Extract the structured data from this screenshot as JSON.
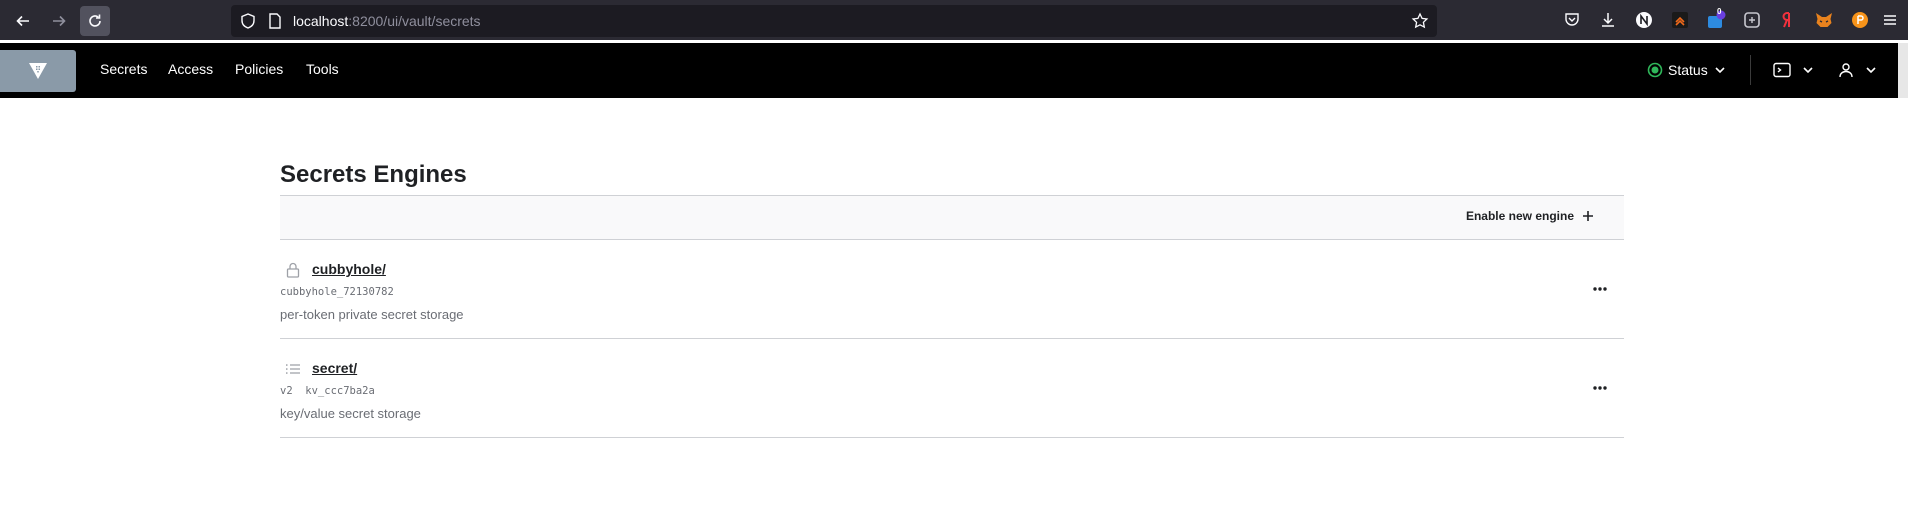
{
  "browser": {
    "url_host": "localhost",
    "url_path": ":8200/ui/vault/secrets",
    "extension_badge": "0"
  },
  "nav": {
    "links": [
      "Secrets",
      "Access",
      "Policies",
      "Tools"
    ],
    "status_label": "Status",
    "status_color": "#2fb75a"
  },
  "main": {
    "title": "Secrets Engines",
    "enable_button": "Enable new engine",
    "engines": [
      {
        "icon": "lock-icon",
        "name": "cubbyhole/",
        "meta": "cubbyhole_72130782",
        "description": "per-token private secret storage"
      },
      {
        "icon": "list-icon",
        "name": "secret/",
        "meta": "v2  kv_ccc7ba2a",
        "description": "key/value secret storage"
      }
    ]
  }
}
